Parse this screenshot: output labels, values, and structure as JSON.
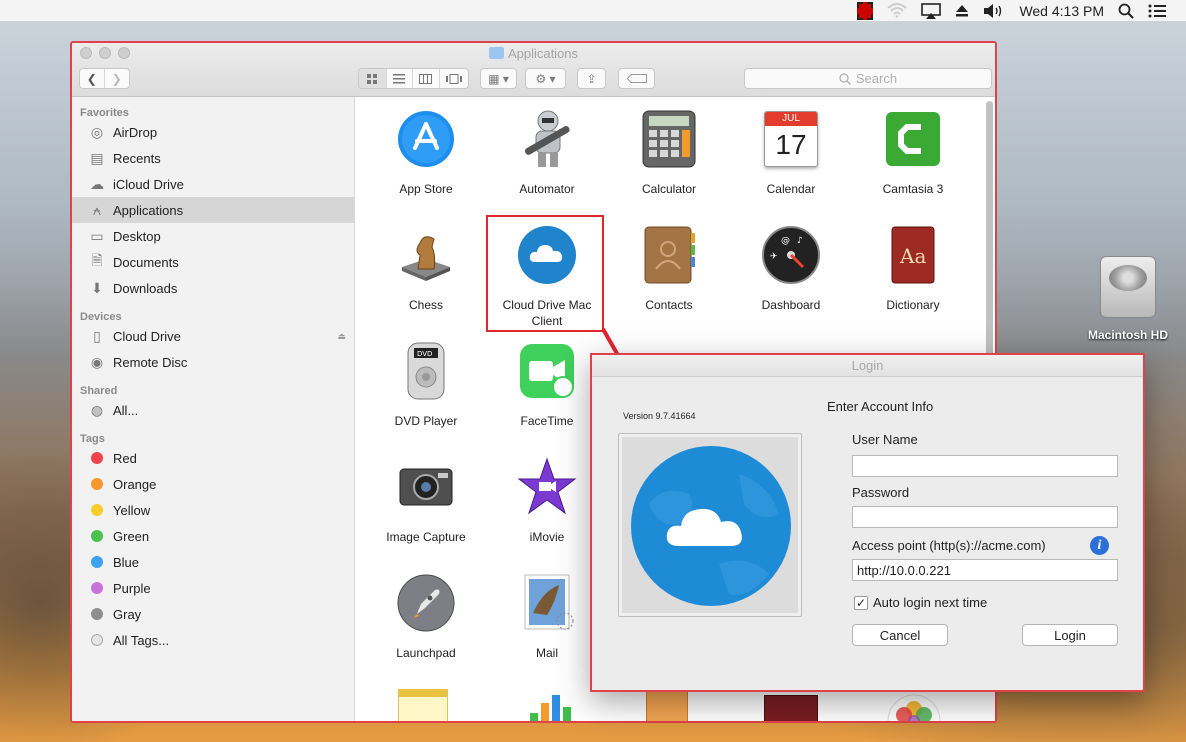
{
  "menubar": {
    "clock": "Wed 4:13 PM"
  },
  "desktop": {
    "disk_label": "Macintosh HD"
  },
  "finder": {
    "title": "Applications",
    "search_placeholder": "Search",
    "sidebar": {
      "favorites_header": "Favorites",
      "favorites": [
        "AirDrop",
        "Recents",
        "iCloud Drive",
        "Applications",
        "Desktop",
        "Documents",
        "Downloads"
      ],
      "devices_header": "Devices",
      "devices": [
        "Cloud Drive",
        "Remote Disc"
      ],
      "shared_header": "Shared",
      "shared": [
        "All..."
      ],
      "tags_header": "Tags",
      "tags": [
        {
          "label": "Red",
          "color": "#f0454d"
        },
        {
          "label": "Orange",
          "color": "#f5972e"
        },
        {
          "label": "Yellow",
          "color": "#f6cd2c"
        },
        {
          "label": "Green",
          "color": "#4cc14e"
        },
        {
          "label": "Blue",
          "color": "#3ba1f0"
        },
        {
          "label": "Purple",
          "color": "#c674d9"
        },
        {
          "label": "Gray",
          "color": "#8e8e8e"
        },
        {
          "label": "All Tags..."
        }
      ]
    },
    "apps": [
      {
        "name": "App Store"
      },
      {
        "name": "Automator"
      },
      {
        "name": "Calculator"
      },
      {
        "name": "Calendar",
        "month": "JUL",
        "day": "17"
      },
      {
        "name": "Camtasia 3"
      },
      {
        "name": "Chess"
      },
      {
        "name": "Cloud Drive Mac Client"
      },
      {
        "name": "Contacts"
      },
      {
        "name": "Dashboard"
      },
      {
        "name": "Dictionary"
      },
      {
        "name": "DVD Player"
      },
      {
        "name": "FaceTime"
      },
      {
        "name": "Image Capture"
      },
      {
        "name": "iMovie"
      },
      {
        "name": "Launchpad"
      },
      {
        "name": "Mail"
      }
    ]
  },
  "login": {
    "title": "Login",
    "version": "Version 9.7.41664",
    "heading": "Enter Account Info",
    "username_label": "User Name",
    "username_value": "",
    "password_label": "Password",
    "password_value": "",
    "access_label": "Access point (http(s)://acme.com)",
    "access_value": "http://10.0.0.221",
    "auto_login_label": "Auto login next time",
    "auto_login_checked": true,
    "cancel_label": "Cancel",
    "login_label": "Login"
  }
}
